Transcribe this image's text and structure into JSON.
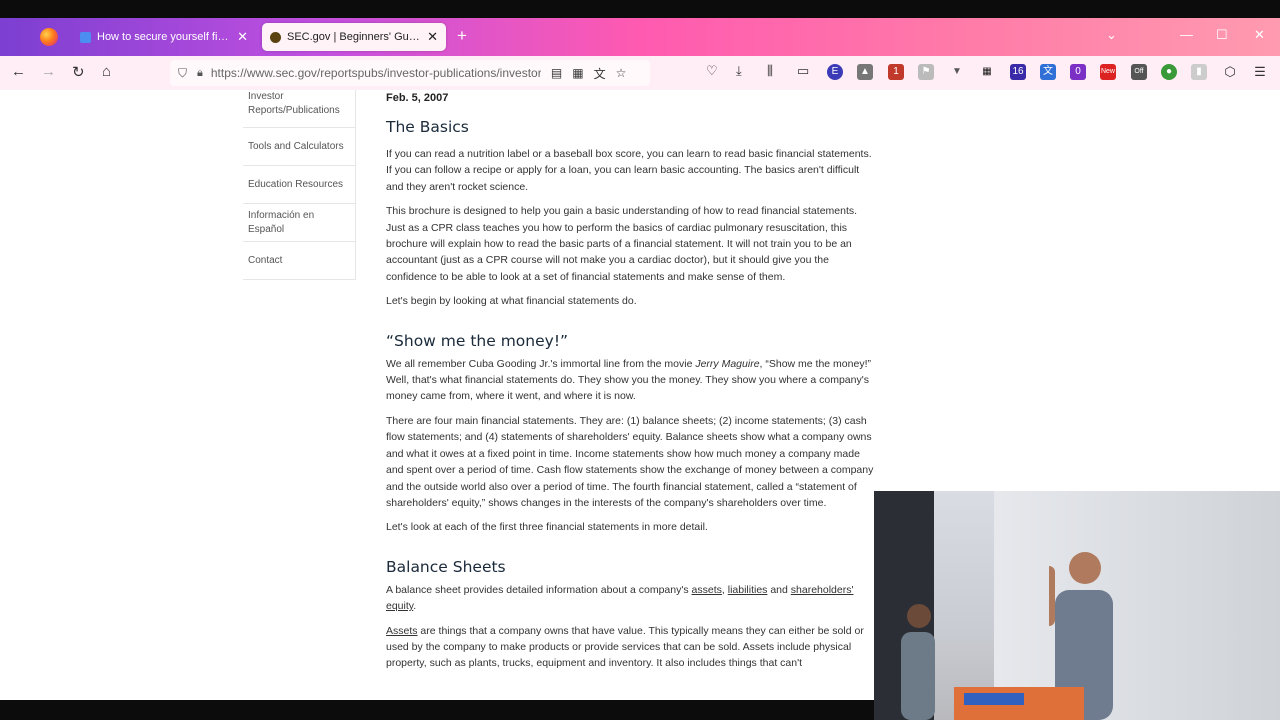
{
  "browser": {
    "tabs": [
      {
        "title": "How to secure yourself financia",
        "active": false
      },
      {
        "title": "SEC.gov | Beginners' Guide to F",
        "active": true
      }
    ],
    "url": "https://www.sec.gov/reportspubs/investor-publications/investor",
    "extension_badges": [
      "1",
      "16",
      "0",
      "New",
      "Off"
    ]
  },
  "sidebar": {
    "items": [
      {
        "label": "Investor Reports/Publications"
      },
      {
        "label": "Tools and Calculators"
      },
      {
        "label": "Education Resources"
      },
      {
        "label": "Información en Español"
      },
      {
        "label": "Contact"
      }
    ]
  },
  "article": {
    "date": "Feb. 5, 2007",
    "basics_heading": "The Basics",
    "basics_p1": "If you can read a nutrition label or a baseball box score, you can learn to read basic financial statements. If you can follow a recipe or apply for a loan, you can learn basic accounting. The basics aren't difficult and they aren't rocket science.",
    "basics_p2": "This brochure is designed to help you gain a basic understanding of how to read financial statements. Just as a CPR class teaches you how to perform the basics of cardiac pulmonary resuscitation, this brochure will explain how to read the basic parts of a financial statement. It will not train you to be an accountant (just as a CPR course will not make you a cardiac doctor), but it should give you the confidence to be able to look at a set of financial statements and make sense of them.",
    "basics_p3": "Let's begin by looking at what financial statements do.",
    "money_heading": "“Show me the money!”",
    "money_p1_a": "We all remember Cuba Gooding Jr.'s immortal line from the movie ",
    "money_p1_movie": "Jerry Maguire",
    "money_p1_b": ", “Show me the money!” Well, that's what financial statements do. They show you the money. They show you where a company's money came from, where it went, and where it is now.",
    "money_p2": "There are four main financial statements. They are: (1) balance sheets; (2) income statements; (3) cash flow statements; and (4) statements of shareholders' equity. Balance sheets show what a company owns and what it owes at a fixed point in time. Income statements show how much money a company made and spent over a period of time. Cash flow statements show the exchange of money between a company and the outside world also over a period of time. The fourth financial statement, called a “statement of shareholders' equity,” shows changes in the interests of the company's shareholders over time.",
    "money_p3": "Let's look at each of the first three financial statements in more detail.",
    "balance_heading": "Balance Sheets",
    "balance_p1_a": "A balance sheet provides detailed information about a company's ",
    "balance_link_assets": "assets",
    "balance_p1_sep": ", ",
    "balance_link_liabilities": "liabilities",
    "balance_p1_and": " and ",
    "balance_link_equity": "shareholders' equity",
    "balance_p1_end": ".",
    "assets_link": "Assets",
    "assets_text": " are things that a company owns that have value. This typically means they can either be sold or used by the company to make products or provide services that can be sold. Assets include physical property, such as plants, trucks, equipment and inventory. It also includes things that can't"
  }
}
